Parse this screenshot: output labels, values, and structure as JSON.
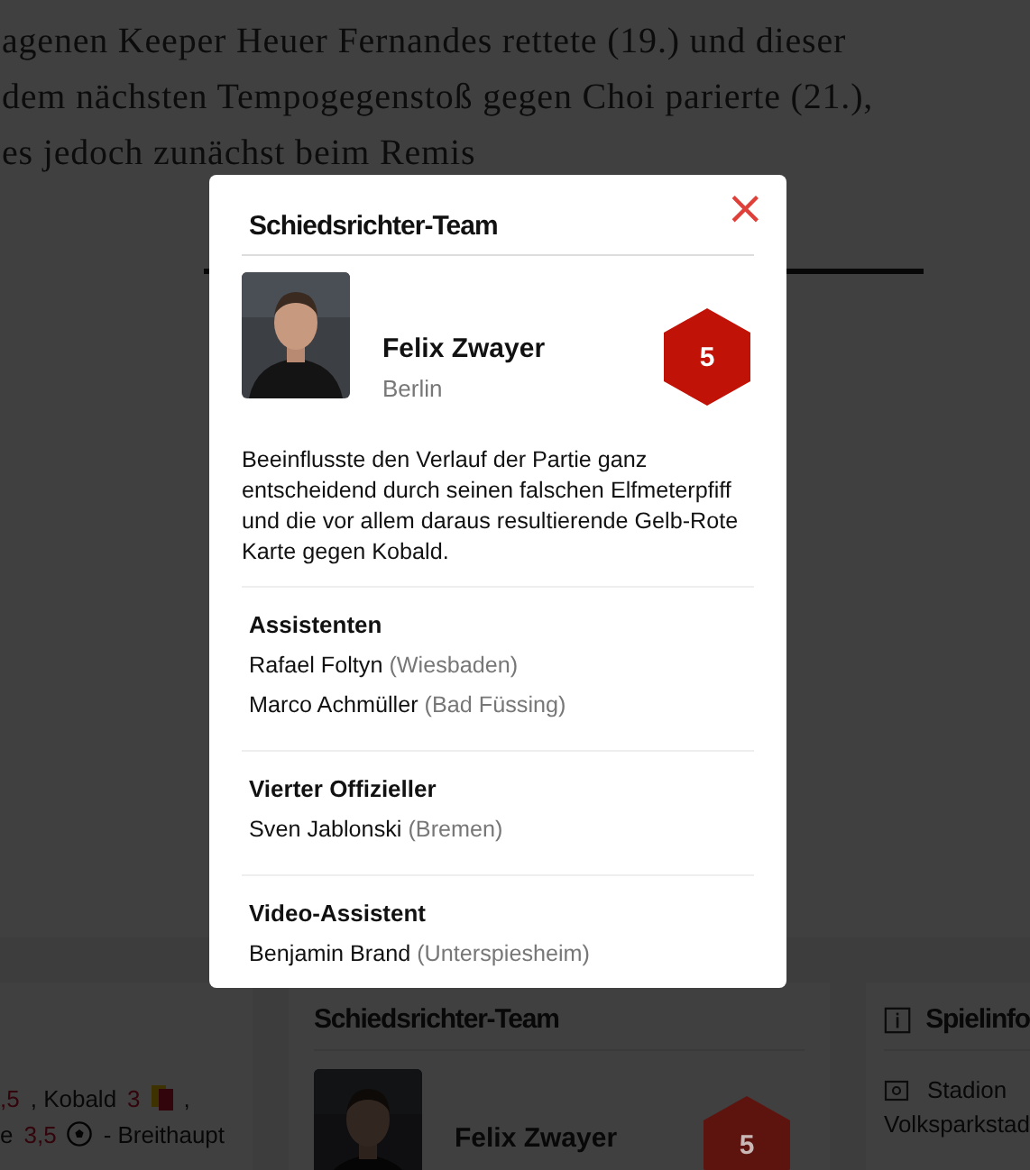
{
  "article": {
    "lines": [
      "agenen Keeper Heuer Fernandes rettete (19.) und dieser",
      "dem nächsten Tempogegenstoß gegen Choi parierte (21.),",
      "es jedoch zunächst beim Remis"
    ]
  },
  "background_cards": {
    "ratings_rows": [
      [
        {
          "kind": "grade",
          "text": ",5"
        },
        {
          "kind": "name",
          "text": ", Kobald"
        },
        {
          "kind": "grade",
          "text": "3"
        },
        {
          "kind": "card"
        },
        {
          "kind": "name",
          "text": ","
        }
      ],
      [
        {
          "kind": "name",
          "text": "e"
        },
        {
          "kind": "grade",
          "text": "3,5"
        },
        {
          "kind": "ball"
        },
        {
          "kind": "name",
          "text": "- Breithaupt"
        }
      ]
    ],
    "referee_card": {
      "title": "Schiedsrichter-Team",
      "name": "Felix Zwayer",
      "grade": "5"
    },
    "info_card": {
      "title": "Spielinfo",
      "items": [
        {
          "label": "Stadion",
          "value": "Volksparkstad"
        }
      ]
    }
  },
  "modal": {
    "title": "Schiedsrichter-Team",
    "close": "×",
    "referee": {
      "name": "Felix Zwayer",
      "city": "Berlin",
      "grade": "5"
    },
    "description": "Beeinflusste den Verlauf der Partie ganz entscheidend durch seinen falschen Elfmeterpfiff und die vor allem daraus resultierende Gelb-Rote Karte gegen Kobald.",
    "sections": [
      {
        "heading": "Assistenten",
        "people": [
          {
            "name": "Rafael Foltyn",
            "city": "(Wiesbaden)"
          },
          {
            "name": "Marco Achmüller",
            "city": "(Bad Füssing)"
          }
        ]
      },
      {
        "heading": "Vierter Offizieller",
        "people": [
          {
            "name": "Sven Jablonski",
            "city": "(Bremen)"
          }
        ]
      },
      {
        "heading": "Video-Assistent",
        "people": [
          {
            "name": "Benjamin Brand",
            "city": "(Unterspiesheim)"
          }
        ]
      }
    ]
  }
}
